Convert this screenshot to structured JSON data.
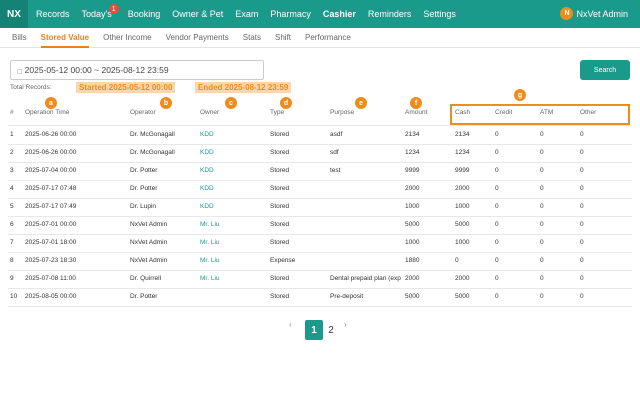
{
  "nav": {
    "brand": "NX",
    "items": [
      {
        "label": "Records",
        "badge": null,
        "active": false
      },
      {
        "label": "Today's",
        "badge": "1",
        "active": false
      },
      {
        "label": "Booking",
        "badge": null,
        "active": false
      },
      {
        "label": "Owner & Pet",
        "badge": null,
        "active": false
      },
      {
        "label": "Exam",
        "badge": null,
        "active": false
      },
      {
        "label": "Pharmacy",
        "badge": null,
        "active": false
      },
      {
        "label": "Cashier",
        "badge": null,
        "active": true
      },
      {
        "label": "Reminders",
        "badge": null,
        "active": false
      },
      {
        "label": "Settings",
        "badge": null,
        "active": false
      }
    ],
    "user": {
      "initial": "N",
      "name": "NxVet Admin"
    }
  },
  "subtabs": [
    {
      "label": "Bills",
      "active": false
    },
    {
      "label": "Stored Value",
      "active": true
    },
    {
      "label": "Other Income",
      "active": false
    },
    {
      "label": "Vendor Payments",
      "active": false
    },
    {
      "label": "Stats",
      "active": false
    },
    {
      "label": "Shift",
      "active": false
    },
    {
      "label": "Performance",
      "active": false
    }
  ],
  "filter": {
    "date_range": "2025-05-12 00:00 ~ 2025-08-12 23:59",
    "calendar_icon": "calendar-icon",
    "search_label": "Search",
    "total_label": "Total Records:",
    "started_tag": "Started 2025-05-12 00:00",
    "ended_tag": "Ended 2025-08-12 23:59"
  },
  "annotation_markers": [
    "a",
    "b",
    "c",
    "d",
    "e",
    "f",
    "g"
  ],
  "table": {
    "headers": {
      "id": "#",
      "time": "Operation Time",
      "operator": "Operator",
      "owner": "Owner",
      "type": "Type",
      "purpose": "Purpose",
      "amount": "Amount",
      "cash": "Cash",
      "credit": "Credit",
      "atm": "ATM",
      "other": "Other"
    },
    "rows": [
      {
        "id": "1",
        "time": "2025-06-26 00:00",
        "operator": "Dr. McGonagall",
        "owner": "KDD",
        "type": "Stored",
        "purpose": "asdf",
        "amount": "2134",
        "cash": "2134",
        "credit": "0",
        "atm": "0",
        "other": "0"
      },
      {
        "id": "2",
        "time": "2025-06-26 00:00",
        "operator": "Dr. McGonagall",
        "owner": "KDD",
        "type": "Stored",
        "purpose": "sdf",
        "amount": "1234",
        "cash": "1234",
        "credit": "0",
        "atm": "0",
        "other": "0"
      },
      {
        "id": "3",
        "time": "2025-07-04 00:00",
        "operator": "Dr. Potter",
        "owner": "KDD",
        "type": "Stored",
        "purpose": "test",
        "amount": "9999",
        "cash": "9999",
        "credit": "0",
        "atm": "0",
        "other": "0"
      },
      {
        "id": "4",
        "time": "2025-07-17 07:48",
        "operator": "Dr. Potter",
        "owner": "KDD",
        "type": "Stored",
        "purpose": "",
        "amount": "2000",
        "cash": "2000",
        "credit": "0",
        "atm": "0",
        "other": "0"
      },
      {
        "id": "5",
        "time": "2025-07-17 07:49",
        "operator": "Dr. Lupin",
        "owner": "KDD",
        "type": "Stored",
        "purpose": "",
        "amount": "1000",
        "cash": "1000",
        "credit": "0",
        "atm": "0",
        "other": "0"
      },
      {
        "id": "6",
        "time": "2025-07-01 00:00",
        "operator": "NxVet Admin",
        "owner": "Mr. Liu",
        "type": "Stored",
        "purpose": "",
        "amount": "5000",
        "cash": "5000",
        "credit": "0",
        "atm": "0",
        "other": "0"
      },
      {
        "id": "7",
        "time": "2025-07-01 18:00",
        "operator": "NxVet Admin",
        "owner": "Mr. Liu",
        "type": "Stored",
        "purpose": "",
        "amount": "1000",
        "cash": "1000",
        "credit": "0",
        "atm": "0",
        "other": "0"
      },
      {
        "id": "8",
        "time": "2025-07-23 18:30",
        "operator": "NxVet Admin",
        "owner": "Mr. Liu",
        "type": "Expense",
        "purpose": "",
        "amount": "1880",
        "cash": "0",
        "credit": "0",
        "atm": "0",
        "other": "0"
      },
      {
        "id": "9",
        "time": "2025-07-08 11:00",
        "operator": "Dr. Quirrell",
        "owner": "Mr. Liu",
        "type": "Stored",
        "purpose": "Dental prepaid plan (exp",
        "amount": "2000",
        "cash": "2000",
        "credit": "0",
        "atm": "0",
        "other": "0"
      },
      {
        "id": "10",
        "time": "2025-08-05 00:00",
        "operator": "Dr. Potter",
        "owner": "",
        "type": "Stored",
        "purpose": "Pre-deposit",
        "amount": "5000",
        "cash": "5000",
        "credit": "0",
        "atm": "0",
        "other": "0"
      }
    ]
  },
  "pagination": {
    "prev": "‹",
    "pages": [
      "1",
      "2"
    ],
    "current": "1",
    "next": "›"
  },
  "colors": {
    "primary": "#1a9a8a",
    "accent": "#f08c1a",
    "badge": "#e74c3c"
  }
}
